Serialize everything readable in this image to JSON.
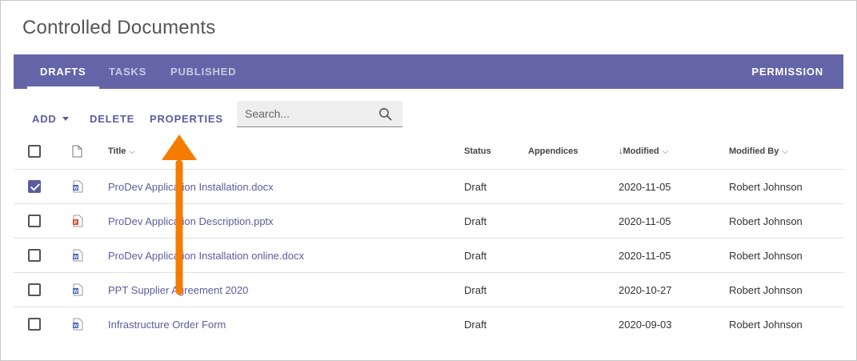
{
  "page": {
    "title": "Controlled Documents"
  },
  "tabs": {
    "drafts": "DRAFTS",
    "tasks": "TASKS",
    "published": "PUBLISHED",
    "permission": "PERMISSION"
  },
  "toolbar": {
    "add_label": "ADD",
    "delete_label": "DELETE",
    "properties_label": "PROPERTIES",
    "search_placeholder": "Search..."
  },
  "table": {
    "headers": {
      "title": "Title",
      "status": "Status",
      "appendices": "Appendices",
      "modified": "Modified",
      "modified_by": "Modified By"
    },
    "rows": [
      {
        "checked": true,
        "file_type": "docx",
        "title": "ProDev Application Installation.docx",
        "status": "Draft",
        "appendices": "",
        "modified": "2020-11-05",
        "modified_by": "Robert Johnson"
      },
      {
        "checked": false,
        "file_type": "pptx",
        "title": "ProDev Application Description.pptx",
        "status": "Draft",
        "appendices": "",
        "modified": "2020-11-05",
        "modified_by": "Robert Johnson"
      },
      {
        "checked": false,
        "file_type": "docx",
        "title": "ProDev Application Installation online.docx",
        "status": "Draft",
        "appendices": "",
        "modified": "2020-11-05",
        "modified_by": "Robert Johnson"
      },
      {
        "checked": false,
        "file_type": "docx",
        "title": "PPT Supplier Agreement 2020",
        "status": "Draft",
        "appendices": "",
        "modified": "2020-10-27",
        "modified_by": "Robert Johnson"
      },
      {
        "checked": false,
        "file_type": "docx",
        "title": "Infrastructure Order Form",
        "status": "Draft",
        "appendices": "",
        "modified": "2020-09-03",
        "modified_by": "Robert Johnson"
      }
    ]
  },
  "colors": {
    "tab_bar": "#6465a9",
    "accent": "#5b5ca0",
    "annotation_arrow": "#f57c00",
    "docx_icon": "#3b5bb5",
    "pptx_icon": "#d04a2f"
  }
}
